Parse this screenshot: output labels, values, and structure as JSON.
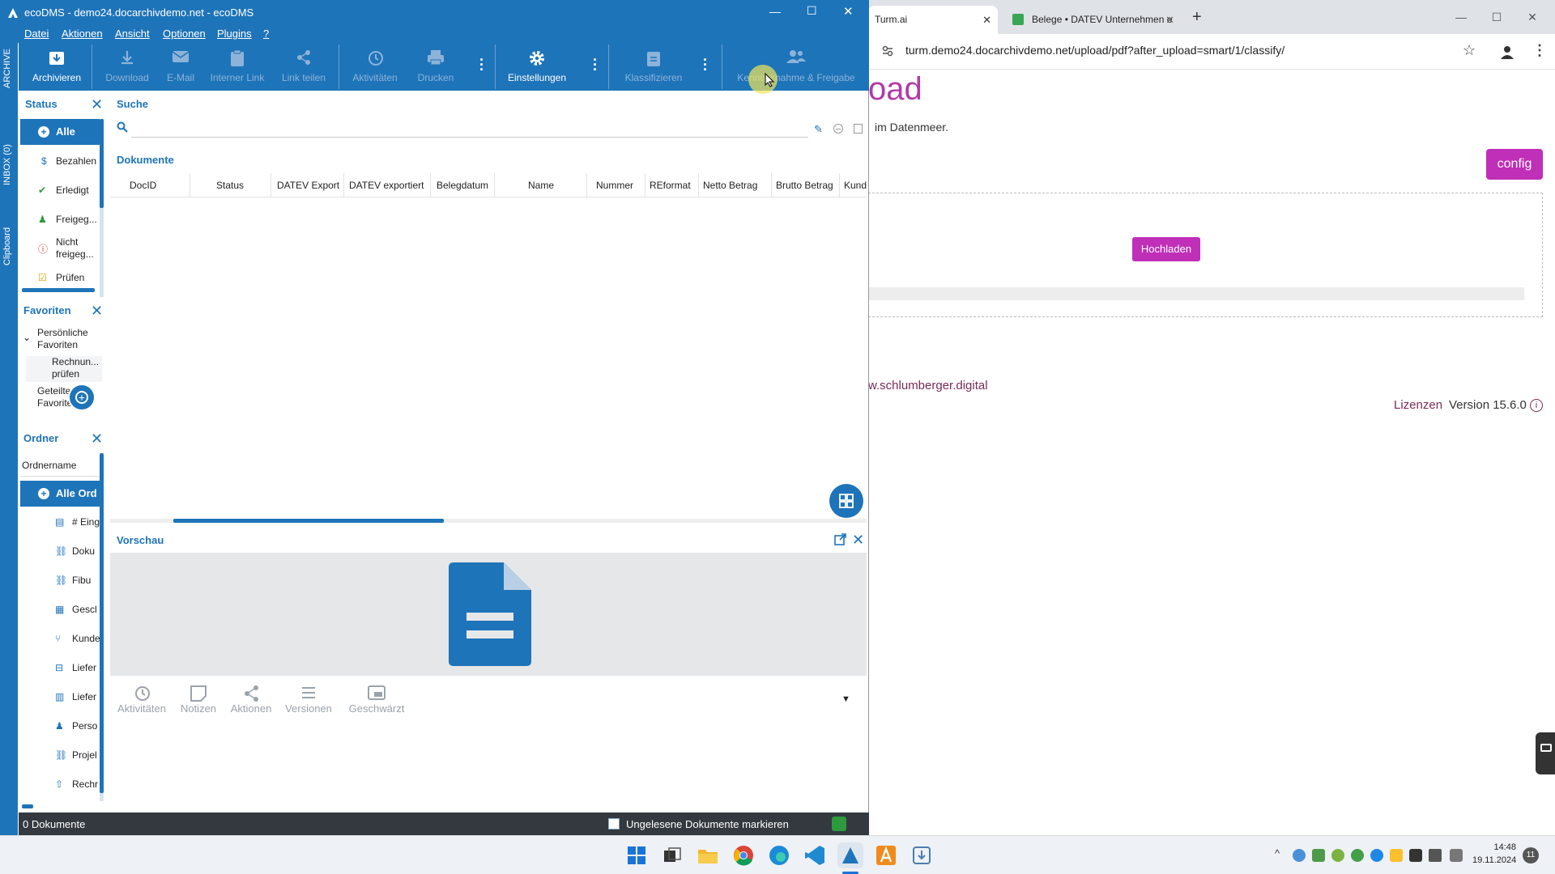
{
  "browser": {
    "tabs": [
      {
        "label": "Turm.ai",
        "active": true
      },
      {
        "label": "Belege • DATEV Unternehmen o",
        "active": false
      }
    ],
    "url": "turm.demo24.docarchivdemo.net/upload/pdf?after_upload=smart/1/classify/",
    "page": {
      "heading_fragment": "oad",
      "subtitle": "im Datenmeer.",
      "config_button": "config",
      "upload_button": "Hochladen",
      "footer_link": "w.schlumberger.digital",
      "licenses_link": "Lizenzen",
      "version": "Version 15.6.0",
      "accent": "#c02fb7"
    }
  },
  "eco": {
    "title": "ecoDMS - demo24.docarchivdemo.net - ecoDMS",
    "accent": "#1e74b9",
    "menu": [
      "Datei",
      "Aktionen",
      "Ansicht",
      "Optionen",
      "Plugins",
      "?"
    ],
    "toolbar": {
      "archivieren": "Archivieren",
      "download": "Download",
      "email": "E-Mail",
      "interner_link": "Interner Link",
      "link_teilen": "Link teilen",
      "aktivitaeten": "Aktivitäten",
      "drucken": "Drucken",
      "einstellungen": "Einstellungen",
      "klassifizieren": "Klassifizieren",
      "kenntnis": "Kenntnisnahme & Freigabe"
    },
    "side_tabs": [
      "ARCHIVE",
      "INBOX (0)",
      "Clipboard"
    ],
    "status": {
      "header": "Status",
      "items": [
        "Alle",
        "Bezahlen",
        "Erledigt",
        "Freigeg...",
        "Nicht freigeg...",
        "Prüfen"
      ]
    },
    "favorites": {
      "header": "Favoriten",
      "personal": "Persönliche Favoriten",
      "item": "Rechnun... prüfen",
      "shared": "Geteilte Favoriten"
    },
    "folders": {
      "header": "Ordner",
      "column": "Ordnername",
      "items": [
        "Alle Ord",
        "# Eing",
        "Doku",
        "Fibu",
        "Gescl",
        "Kunde",
        "Liefer",
        "Liefer",
        "Perso",
        "Projel",
        "Rechr"
      ]
    },
    "search": {
      "header": "Suche",
      "value": ""
    },
    "documents": {
      "header": "Dokumente",
      "columns": [
        "DocID",
        "Status",
        "DATEV Export",
        "DATEV exportiert",
        "Belegdatum",
        "Name",
        "Nummer",
        "REformat",
        "Netto Betrag",
        "Brutto Betrag",
        "Kund"
      ]
    },
    "preview": {
      "header": "Vorschau",
      "buttons": [
        "Aktivitäten",
        "Notizen",
        "Aktionen",
        "Versionen",
        "Geschwärzt"
      ]
    },
    "statusbar": {
      "count": "0 Dokumente",
      "unread": "Ungelesene Dokumente markieren"
    }
  },
  "taskbar": {
    "time": "14:48",
    "date": "19.11.2024",
    "notifications": "11"
  }
}
